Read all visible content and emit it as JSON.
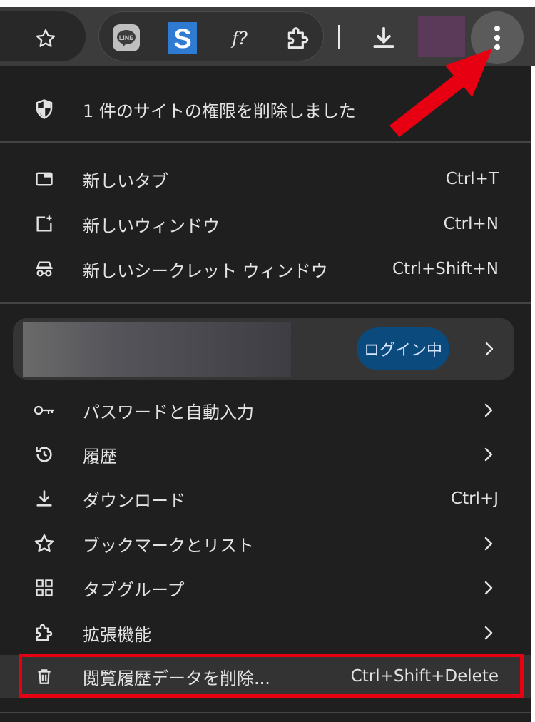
{
  "toolbar": {
    "bookmark_star_icon": "star-icon",
    "extensions": [
      "line-extension-icon",
      "s-extension-icon",
      "fx-extension-icon",
      "puzzle-extensions-icon"
    ],
    "ext_s_letter": "S",
    "ext_fx_label": "f?",
    "download_icon": "download-icon",
    "menu_icon": "more-vert-icon"
  },
  "menu": {
    "permission_notice": "1 件のサイトの権限を削除しました",
    "items_top": [
      {
        "label": "新しいタブ",
        "shortcut": "Ctrl+T",
        "icon": "new-tab-icon"
      },
      {
        "label": "新しいウィンドウ",
        "shortcut": "Ctrl+N",
        "icon": "new-window-icon"
      },
      {
        "label": "新しいシークレット ウィンドウ",
        "shortcut": "Ctrl+Shift+N",
        "icon": "incognito-icon"
      }
    ],
    "profile": {
      "login_label": "ログイン中"
    },
    "items_main": [
      {
        "label": "パスワードと自動入力",
        "icon": "key-icon",
        "submenu": true
      },
      {
        "label": "履歴",
        "icon": "history-icon",
        "submenu": true
      },
      {
        "label": "ダウンロード",
        "shortcut": "Ctrl+J",
        "icon": "download-icon"
      },
      {
        "label": "ブックマークとリスト",
        "icon": "star-icon",
        "submenu": true
      },
      {
        "label": "タブグループ",
        "icon": "grid-icon",
        "submenu": true
      },
      {
        "label": "拡張機能",
        "icon": "puzzle-icon",
        "submenu": true
      },
      {
        "label": "閲覧履歴データを削除...",
        "shortcut": "Ctrl+Shift+Delete",
        "icon": "trash-icon",
        "highlighted": true
      }
    ]
  },
  "colors": {
    "menu_bg": "#1f1f1f",
    "annotation_red": "#e60012",
    "login_badge": "#0b4a7c"
  }
}
